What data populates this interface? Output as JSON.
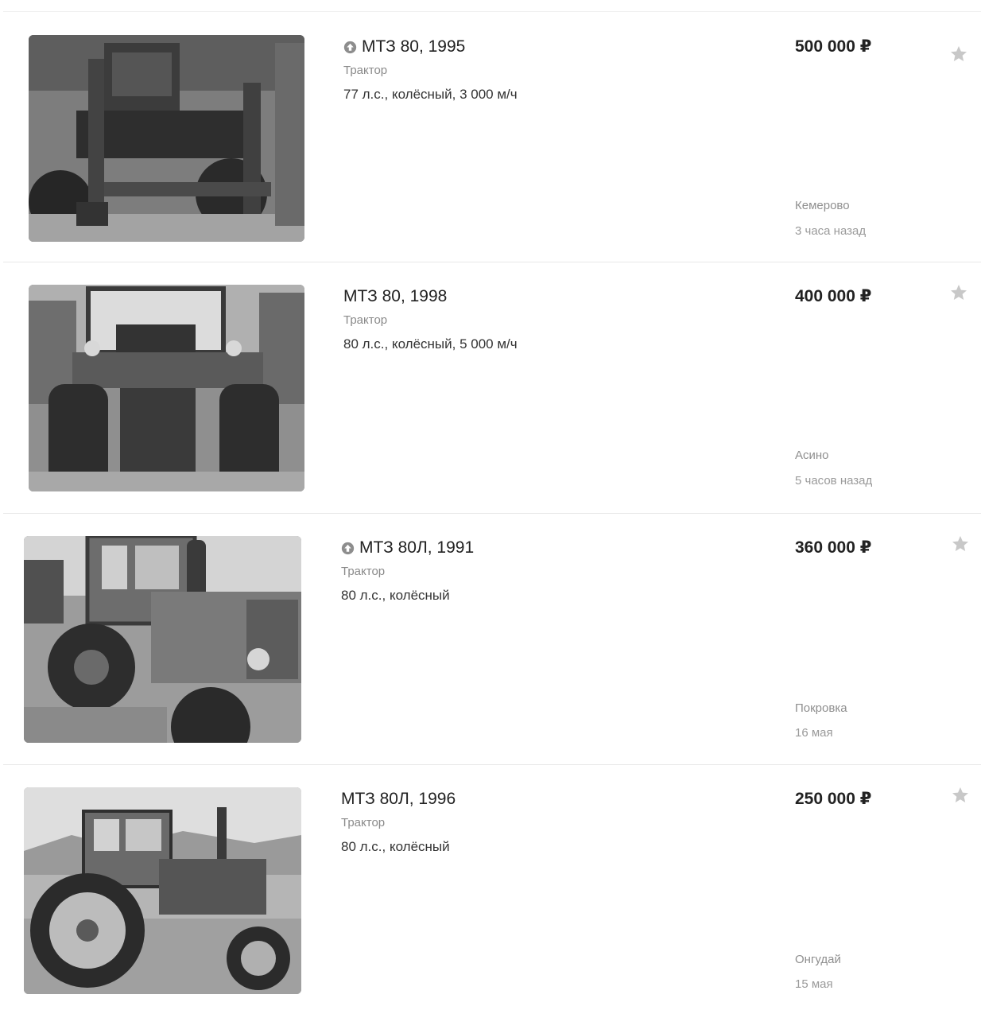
{
  "listings": [
    {
      "promoted": true,
      "title": "МТЗ 80, 1995",
      "category": "Трактор",
      "specs": "77 л.с., колёсный, 3 000 м/ч",
      "price": "500 000 ₽",
      "location": "Кемерово",
      "posted": "3 часа назад",
      "photo_icon": "tractor-photo-loader"
    },
    {
      "promoted": false,
      "title": "МТЗ 80, 1998",
      "category": "Трактор",
      "specs": "80 л.с., колёсный, 5 000 м/ч",
      "price": "400 000 ₽",
      "location": "Асино",
      "posted": "5 часов назад",
      "photo_icon": "tractor-photo-rear"
    },
    {
      "promoted": true,
      "title": "МТЗ 80Л, 1991",
      "category": "Трактор",
      "specs": "80 л.с., колёсный",
      "price": "360 000 ₽",
      "location": "Покровка",
      "posted": "16 мая",
      "photo_icon": "tractor-photo-front"
    },
    {
      "promoted": false,
      "title": "МТЗ 80Л, 1996",
      "category": "Трактор",
      "specs": "80 л.с., колёсный",
      "price": "250 000 ₽",
      "location": "Онгудай",
      "posted": "15 мая",
      "photo_icon": "tractor-photo-side"
    }
  ],
  "icons": {
    "promoted": "arrow-up-circle-icon",
    "favorite": "star-icon"
  },
  "colors": {
    "text": "#222222",
    "muted": "#8a8a8a",
    "star": "#c8c8c8",
    "promo_icon": "#8d8d8d"
  }
}
